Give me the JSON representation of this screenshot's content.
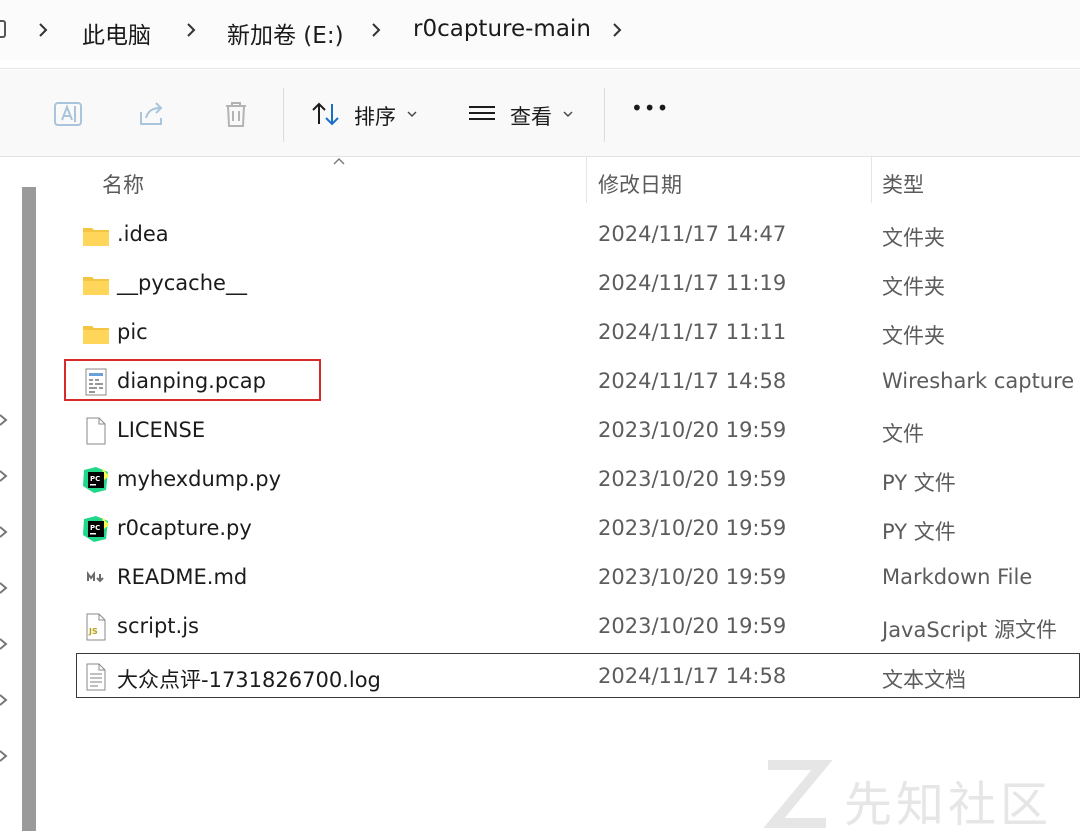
{
  "breadcrumb": {
    "items": [
      {
        "label": "此电脑"
      },
      {
        "label": "新加卷 (E:)"
      },
      {
        "label": "r0capture-main"
      }
    ]
  },
  "commandbar": {
    "sort_label": "排序",
    "view_label": "查看",
    "more_label": "•••"
  },
  "columns": {
    "name": "名称",
    "date": "修改日期",
    "type": "类型"
  },
  "files": [
    {
      "name": ".idea",
      "date": "2024/11/17 14:47",
      "type": "文件夹",
      "icon": "folder-icon"
    },
    {
      "name": "__pycache__",
      "date": "2024/11/17 11:19",
      "type": "文件夹",
      "icon": "folder-icon"
    },
    {
      "name": "pic",
      "date": "2024/11/17 11:11",
      "type": "文件夹",
      "icon": "folder-icon"
    },
    {
      "name": "dianping.pcap",
      "date": "2024/11/17 14:58",
      "type": "Wireshark capture f",
      "icon": "pcap-file-icon"
    },
    {
      "name": "LICENSE",
      "date": "2023/10/20 19:59",
      "type": "文件",
      "icon": "blank-file-icon"
    },
    {
      "name": "myhexdump.py",
      "date": "2023/10/20 19:59",
      "type": "PY 文件",
      "icon": "pycharm-file-icon"
    },
    {
      "name": "r0capture.py",
      "date": "2023/10/20 19:59",
      "type": "PY 文件",
      "icon": "pycharm-file-icon"
    },
    {
      "name": "README.md",
      "date": "2023/10/20 19:59",
      "type": "Markdown File",
      "icon": "markdown-file-icon"
    },
    {
      "name": "script.js",
      "date": "2023/10/20 19:59",
      "type": "JavaScript 源文件",
      "icon": "js-file-icon"
    },
    {
      "name": "大众点评-1731826700.log",
      "date": "2024/11/17 14:58",
      "type": "文本文档",
      "icon": "text-file-icon"
    }
  ],
  "watermark": {
    "text": "先知社区"
  },
  "colors": {
    "folder": "#f4c542",
    "highlight": "#d62b2b",
    "pycharm_green": "#21d789"
  }
}
